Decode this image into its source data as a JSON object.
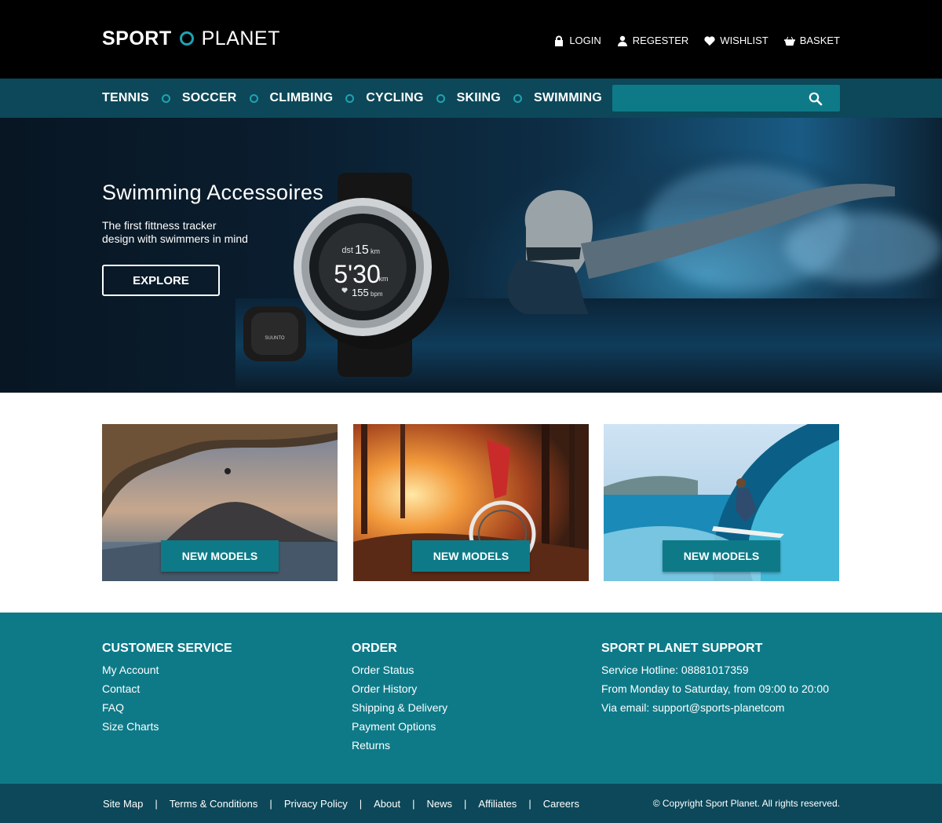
{
  "brand": {
    "name_bold": "SPORT",
    "name_light": "PLANET"
  },
  "top_links": [
    {
      "label": "LOGIN",
      "icon": "lock-icon"
    },
    {
      "label": "REGESTER",
      "icon": "user-icon"
    },
    {
      "label": "WISHLIST",
      "icon": "heart-icon"
    },
    {
      "label": "BASKET",
      "icon": "basket-icon"
    }
  ],
  "nav": {
    "items": [
      "TENNIS",
      "SOCCER",
      "CLIMBING",
      "CYCLING",
      "SKIING",
      "SWIMMING"
    ],
    "search_placeholder": ""
  },
  "hero": {
    "title": "Swimming Accessoires",
    "subtitle_line1": "The first fittness tracker",
    "subtitle_line2": "design with swimmers in mind",
    "button": "EXPLORE",
    "watch": {
      "dst_label": "dst",
      "dst_value": "15",
      "dst_unit": "km",
      "pace": "5'30",
      "pace_unit": "/km",
      "bpm_value": "155",
      "bpm_unit": "bpm",
      "brand": "SUUNTO"
    }
  },
  "tiles": [
    {
      "button": "NEW MODELS",
      "scene": "climbing"
    },
    {
      "button": "NEW MODELS",
      "scene": "cycling"
    },
    {
      "button": "NEW MODELS",
      "scene": "surfing"
    }
  ],
  "footer": {
    "customer_service": {
      "title": "CUSTOMER SERVICE",
      "links": [
        "My Account",
        "Contact",
        "FAQ",
        "Size Charts"
      ]
    },
    "order": {
      "title": "ORDER",
      "links": [
        "Order Status",
        "Order History",
        "Shipping & Delivery",
        "Payment Options",
        "Returns"
      ]
    },
    "support": {
      "title": "SPORT PLANET SUPPORT",
      "lines": [
        "Service Hotline: 08881017359",
        "From Monday to Saturday, from 09:00 to 20:00",
        "Via email: support@sports-planetcom"
      ]
    }
  },
  "bottom": {
    "links": [
      "Site Map",
      "Terms & Conditions",
      "Privacy Policy",
      "About",
      "News",
      "Affiliates",
      "Careers"
    ],
    "separator": "|",
    "copyright": "© Copyright Sport Planet. All rights reserved."
  },
  "colors": {
    "accent": "#0e7a88",
    "nav_bg": "#0c4859",
    "header_bg": "#000000",
    "ring": "#1ea3b3"
  }
}
